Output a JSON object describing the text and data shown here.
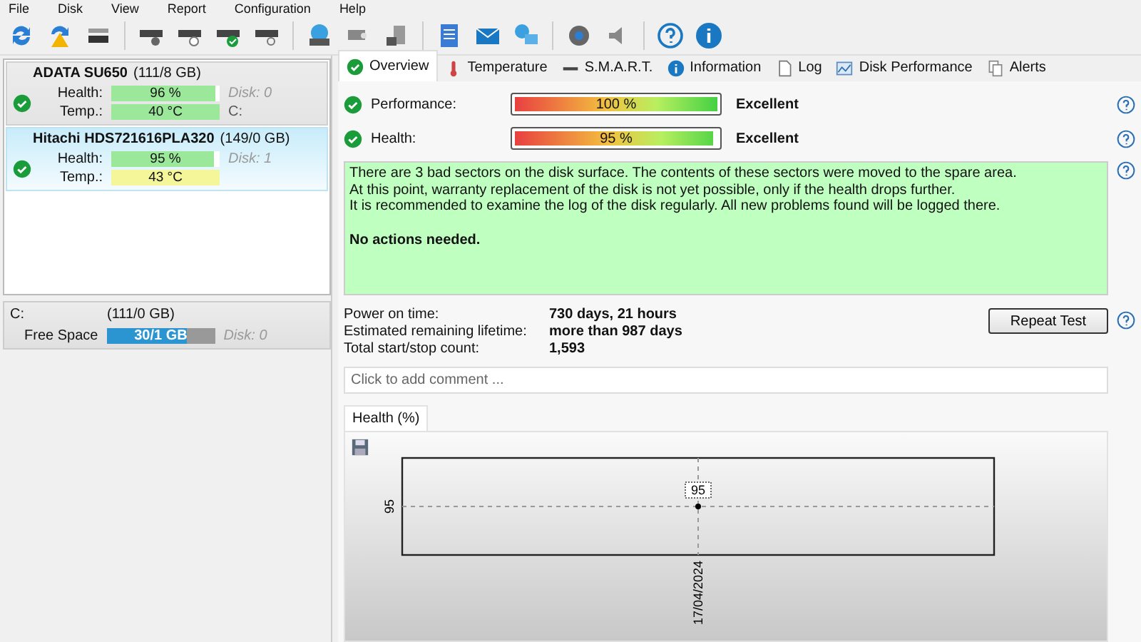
{
  "menu": [
    "File",
    "Disk",
    "View",
    "Report",
    "Configuration",
    "Help"
  ],
  "disks": [
    {
      "name": "ADATA SU650",
      "size": "(111/8 GB)",
      "selected": false,
      "health_label": "Health:",
      "health": {
        "value": "96 %",
        "level": 0.96
      },
      "disk": "Disk: 0",
      "temp_label": "Temp.:",
      "temp": {
        "value": "40 °C",
        "color": "#9be89b"
      },
      "drive": "C:"
    },
    {
      "name": "Hitachi HDS721616PLA320",
      "size": "(149/0 GB)",
      "selected": true,
      "health_label": "Health:",
      "health": {
        "value": "95 %",
        "level": 0.95
      },
      "disk": "Disk: 1",
      "temp_label": "Temp.:",
      "temp": {
        "value": "43 °C",
        "color": "#f5f59a"
      }
    }
  ],
  "volume": {
    "name": "C:",
    "size": "(111/0 GB)",
    "label": "Free Space",
    "value": "30/1 GB",
    "level": 0.74,
    "disk": "Disk: 0"
  },
  "tabs": [
    {
      "label": "Overview",
      "selected": true
    },
    {
      "label": "Temperature",
      "selected": false
    },
    {
      "label": "S.M.A.R.T.",
      "selected": false
    },
    {
      "label": "Information",
      "selected": false
    },
    {
      "label": "Log",
      "selected": false
    },
    {
      "label": "Disk Performance",
      "selected": false
    },
    {
      "label": "Alerts",
      "selected": false
    }
  ],
  "meters": [
    {
      "label": "Performance:",
      "value": "100 %",
      "level": 1.0,
      "rating": "Excellent"
    },
    {
      "label": "Health:",
      "value": "95 %",
      "level": 0.95,
      "rating": "Excellent"
    }
  ],
  "status_text": [
    "There are 3 bad sectors on the disk surface. The contents of these sectors were moved to the spare area.",
    "At this point, warranty replacement of the disk is not yet possible, only if the health drops further.",
    "It is recommended to examine the log of the disk regularly. All new problems found will be logged there."
  ],
  "status_action": "No actions needed.",
  "stats": [
    {
      "label": "Power on time:",
      "value": "730 days, 21 hours"
    },
    {
      "label": "Estimated remaining lifetime:",
      "value": "more than 987 days"
    },
    {
      "label": "Total start/stop count:",
      "value": "1,593"
    }
  ],
  "repeat_button": "Repeat Test",
  "comment": {
    "placeholder": "Click to add comment ..."
  },
  "chart_tab": {
    "label": "Health (%)",
    "selected": true
  },
  "chart": {
    "y_tick": "95",
    "point_label": "95",
    "x_label": "17/04/2024"
  }
}
